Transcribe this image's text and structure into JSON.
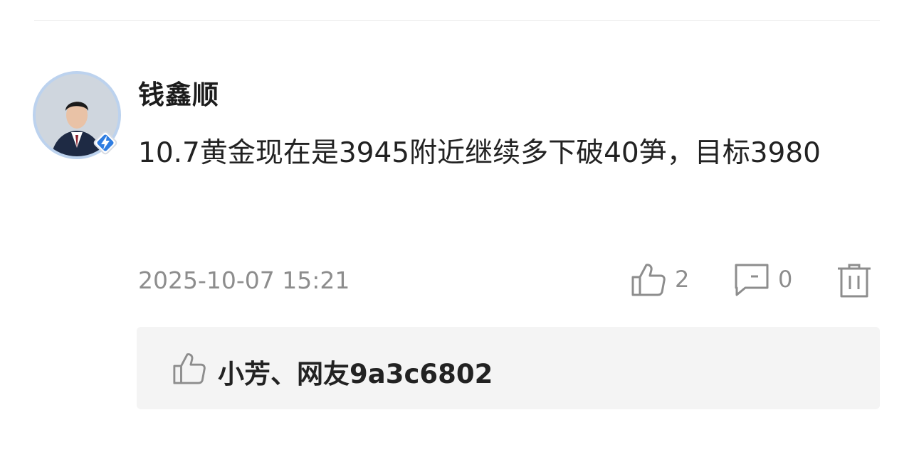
{
  "post": {
    "username": "钱鑫顺",
    "content": "10.7黄金现在是3945附近继续多下破40笋，目标3980",
    "timestamp": "2025-10-07 15:21"
  },
  "actions": {
    "like_count": "2",
    "comment_count": "0"
  },
  "likes": {
    "names": "小芳、网友9a3c6802"
  },
  "icons": {
    "like": "thumbs-up-icon",
    "comment": "comment-bubble-icon",
    "delete": "trash-icon",
    "badge": "lightning-badge-icon"
  },
  "colors": {
    "text_primary": "#222222",
    "text_secondary": "#8d8d8d",
    "likes_background": "#f4f4f4",
    "badge_accent": "#2f7de1"
  }
}
